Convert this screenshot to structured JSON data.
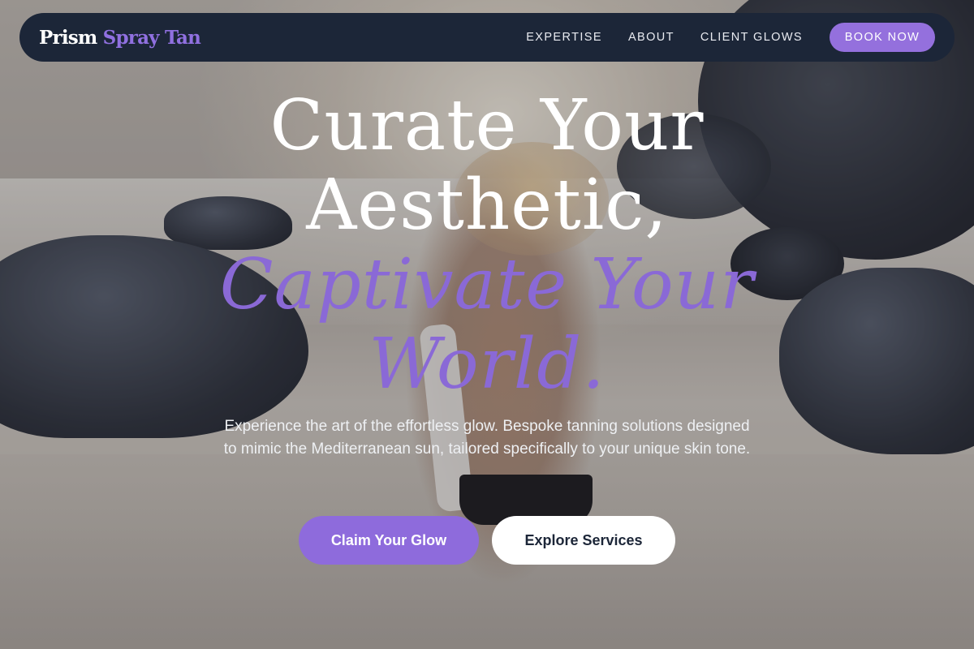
{
  "brand": {
    "name": "Prism",
    "accent": "Spray Tan",
    "colors": {
      "accent": "#9070e0",
      "nav_bg": "#1c2638"
    }
  },
  "nav": {
    "links": [
      "EXPERTISE",
      "ABOUT",
      "CLIENT GLOWS"
    ],
    "cta_label": "BOOK NOW"
  },
  "hero": {
    "headline_line1": "Curate Your",
    "headline_line2": "Aesthetic,",
    "headline_accent_line1": "Captivate Your",
    "headline_accent_line2": "World.",
    "lede": "Experience the art of the effortless glow. Bespoke tanning solutions designed to mimic the Mediterranean sun, tailored specifically to your unique skin tone.",
    "primary_cta": "Claim Your Glow",
    "secondary_cta": "Explore Services"
  }
}
